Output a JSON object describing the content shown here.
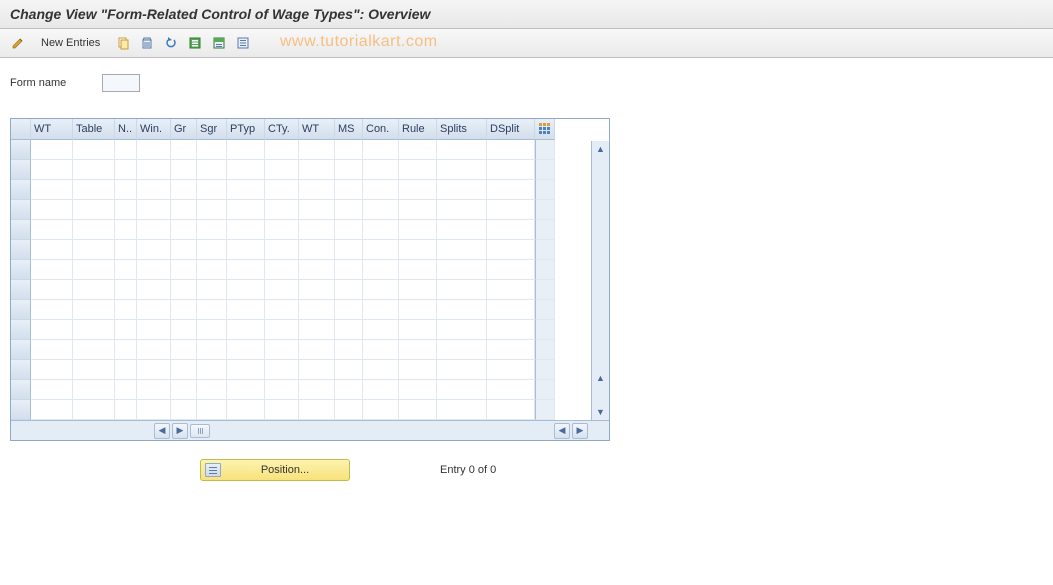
{
  "title": "Change View \"Form-Related Control of Wage Types\": Overview",
  "toolbar": {
    "new_entries_label": "New Entries"
  },
  "watermark": "www.tutorialkart.com",
  "form": {
    "label": "Form name",
    "value": ""
  },
  "table": {
    "columns": [
      "WT",
      "Table",
      "N..",
      "Win.",
      "Gr",
      "Sgr",
      "PTyp",
      "CTy.",
      "WT",
      "MS",
      "Con.",
      "Rule",
      "Splits",
      "DSplit"
    ],
    "rows": [
      [
        "",
        "",
        "",
        "",
        "",
        "",
        "",
        "",
        "",
        "",
        "",
        "",
        "",
        ""
      ],
      [
        "",
        "",
        "",
        "",
        "",
        "",
        "",
        "",
        "",
        "",
        "",
        "",
        "",
        ""
      ],
      [
        "",
        "",
        "",
        "",
        "",
        "",
        "",
        "",
        "",
        "",
        "",
        "",
        "",
        ""
      ],
      [
        "",
        "",
        "",
        "",
        "",
        "",
        "",
        "",
        "",
        "",
        "",
        "",
        "",
        ""
      ],
      [
        "",
        "",
        "",
        "",
        "",
        "",
        "",
        "",
        "",
        "",
        "",
        "",
        "",
        ""
      ],
      [
        "",
        "",
        "",
        "",
        "",
        "",
        "",
        "",
        "",
        "",
        "",
        "",
        "",
        ""
      ],
      [
        "",
        "",
        "",
        "",
        "",
        "",
        "",
        "",
        "",
        "",
        "",
        "",
        "",
        ""
      ],
      [
        "",
        "",
        "",
        "",
        "",
        "",
        "",
        "",
        "",
        "",
        "",
        "",
        "",
        ""
      ],
      [
        "",
        "",
        "",
        "",
        "",
        "",
        "",
        "",
        "",
        "",
        "",
        "",
        "",
        ""
      ],
      [
        "",
        "",
        "",
        "",
        "",
        "",
        "",
        "",
        "",
        "",
        "",
        "",
        "",
        ""
      ],
      [
        "",
        "",
        "",
        "",
        "",
        "",
        "",
        "",
        "",
        "",
        "",
        "",
        "",
        ""
      ],
      [
        "",
        "",
        "",
        "",
        "",
        "",
        "",
        "",
        "",
        "",
        "",
        "",
        "",
        ""
      ],
      [
        "",
        "",
        "",
        "",
        "",
        "",
        "",
        "",
        "",
        "",
        "",
        "",
        "",
        ""
      ],
      [
        "",
        "",
        "",
        "",
        "",
        "",
        "",
        "",
        "",
        "",
        "",
        "",
        "",
        ""
      ]
    ]
  },
  "position": {
    "button_label": "Position...",
    "entry_label": "Entry 0 of 0"
  }
}
